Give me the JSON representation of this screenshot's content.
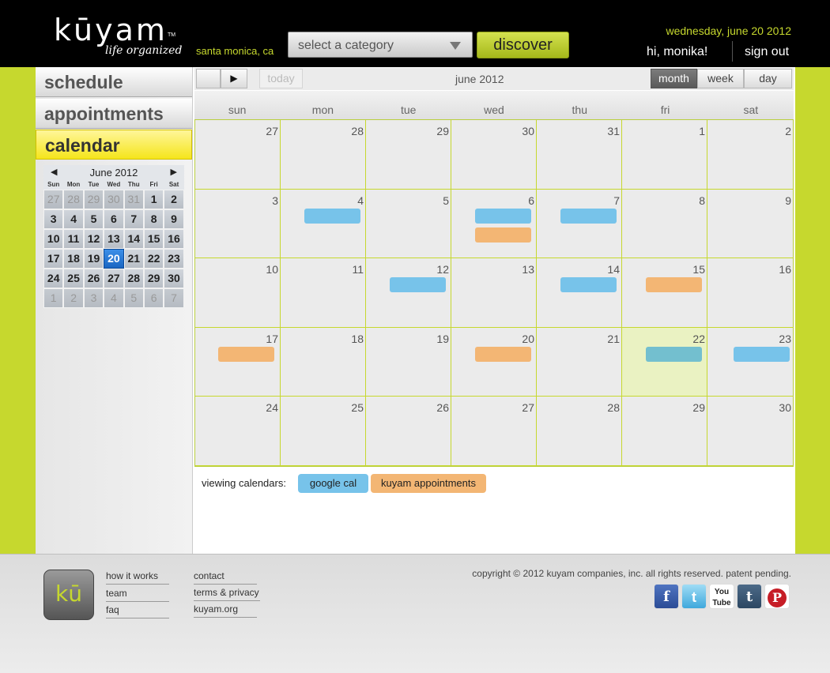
{
  "header": {
    "logo_word": "kūyam",
    "logo_tm": "TM",
    "logo_tagline": "life organized",
    "location": "santa monica, ca",
    "category_placeholder": "select a category",
    "discover_label": "discover",
    "date": "wednesday, june 20 2012",
    "greeting": "hi, monika!",
    "sign_out": "sign out"
  },
  "sidebar": {
    "tabs": [
      {
        "label": "schedule"
      },
      {
        "label": "appointments"
      },
      {
        "label": "calendar",
        "active": true
      }
    ]
  },
  "mini_calendar": {
    "prev": "◀",
    "next": "▶",
    "title": "June 2012",
    "dow": [
      "Sun",
      "Mon",
      "Tue",
      "Wed",
      "Thu",
      "Fri",
      "Sat"
    ],
    "days": [
      {
        "d": "27",
        "other": true
      },
      {
        "d": "28",
        "other": true
      },
      {
        "d": "29",
        "other": true
      },
      {
        "d": "30",
        "other": true
      },
      {
        "d": "31",
        "other": true
      },
      {
        "d": "1"
      },
      {
        "d": "2"
      },
      {
        "d": "3"
      },
      {
        "d": "4"
      },
      {
        "d": "5"
      },
      {
        "d": "6"
      },
      {
        "d": "7"
      },
      {
        "d": "8"
      },
      {
        "d": "9"
      },
      {
        "d": "10"
      },
      {
        "d": "11"
      },
      {
        "d": "12"
      },
      {
        "d": "13"
      },
      {
        "d": "14"
      },
      {
        "d": "15"
      },
      {
        "d": "16"
      },
      {
        "d": "17"
      },
      {
        "d": "18"
      },
      {
        "d": "19"
      },
      {
        "d": "20",
        "today": true
      },
      {
        "d": "21"
      },
      {
        "d": "22"
      },
      {
        "d": "23"
      },
      {
        "d": "24"
      },
      {
        "d": "25"
      },
      {
        "d": "26"
      },
      {
        "d": "27"
      },
      {
        "d": "28"
      },
      {
        "d": "29"
      },
      {
        "d": "30"
      },
      {
        "d": "1",
        "other": true
      },
      {
        "d": "2",
        "other": true
      },
      {
        "d": "3",
        "other": true
      },
      {
        "d": "4",
        "other": true
      },
      {
        "d": "5",
        "other": true
      },
      {
        "d": "6",
        "other": true
      },
      {
        "d": "7",
        "other": true
      }
    ]
  },
  "calendar": {
    "prev_label": "",
    "next_label": "▶",
    "today_label": "today",
    "month_title": "june 2012",
    "views": {
      "month": "month",
      "week": "week",
      "day": "day"
    },
    "active_view": "month",
    "dow": [
      "sun",
      "mon",
      "tue",
      "wed",
      "thu",
      "fri",
      "sat"
    ],
    "cells": [
      {
        "d": "27"
      },
      {
        "d": "28"
      },
      {
        "d": "29"
      },
      {
        "d": "30"
      },
      {
        "d": "31"
      },
      {
        "d": "1"
      },
      {
        "d": "2"
      },
      {
        "d": "3"
      },
      {
        "d": "4",
        "events": [
          "google"
        ]
      },
      {
        "d": "5"
      },
      {
        "d": "6",
        "events": [
          "google",
          "kuyam"
        ]
      },
      {
        "d": "7",
        "events": [
          "google"
        ]
      },
      {
        "d": "8"
      },
      {
        "d": "9"
      },
      {
        "d": "10"
      },
      {
        "d": "11"
      },
      {
        "d": "12",
        "events": [
          "google"
        ]
      },
      {
        "d": "13"
      },
      {
        "d": "14",
        "events": [
          "google"
        ]
      },
      {
        "d": "15",
        "events": [
          "kuyam"
        ]
      },
      {
        "d": "16"
      },
      {
        "d": "17",
        "events": [
          "kuyam"
        ]
      },
      {
        "d": "18"
      },
      {
        "d": "19"
      },
      {
        "d": "20",
        "events": [
          "kuyam"
        ]
      },
      {
        "d": "21"
      },
      {
        "d": "22",
        "highlight": true,
        "events": [
          "selected"
        ]
      },
      {
        "d": "23",
        "events": [
          "google"
        ]
      },
      {
        "d": "24"
      },
      {
        "d": "25"
      },
      {
        "d": "26"
      },
      {
        "d": "27"
      },
      {
        "d": "28"
      },
      {
        "d": "29"
      },
      {
        "d": "30"
      }
    ],
    "legend_label": "viewing calendars:",
    "legend": {
      "google": "google cal",
      "kuyam": "kuyam appointments"
    }
  },
  "colors": {
    "accent": "#c6d82e",
    "google_event": "#77c3ea",
    "kuyam_event": "#f3b674",
    "selected_event": "#73bfcf",
    "today": "#1a66c2"
  },
  "footer": {
    "logo_text": "kū",
    "links_col1": [
      "how it works",
      "team",
      "faq"
    ],
    "links_col2": [
      "contact",
      "terms & privacy",
      "kuyam.org"
    ],
    "copyright": "copyright © 2012 kuyam companies, inc. all rights reserved. patent pending.",
    "social": {
      "facebook": "f",
      "twitter": "t",
      "youtube": "You Tube",
      "tumblr": "t",
      "pinterest": "P"
    }
  }
}
